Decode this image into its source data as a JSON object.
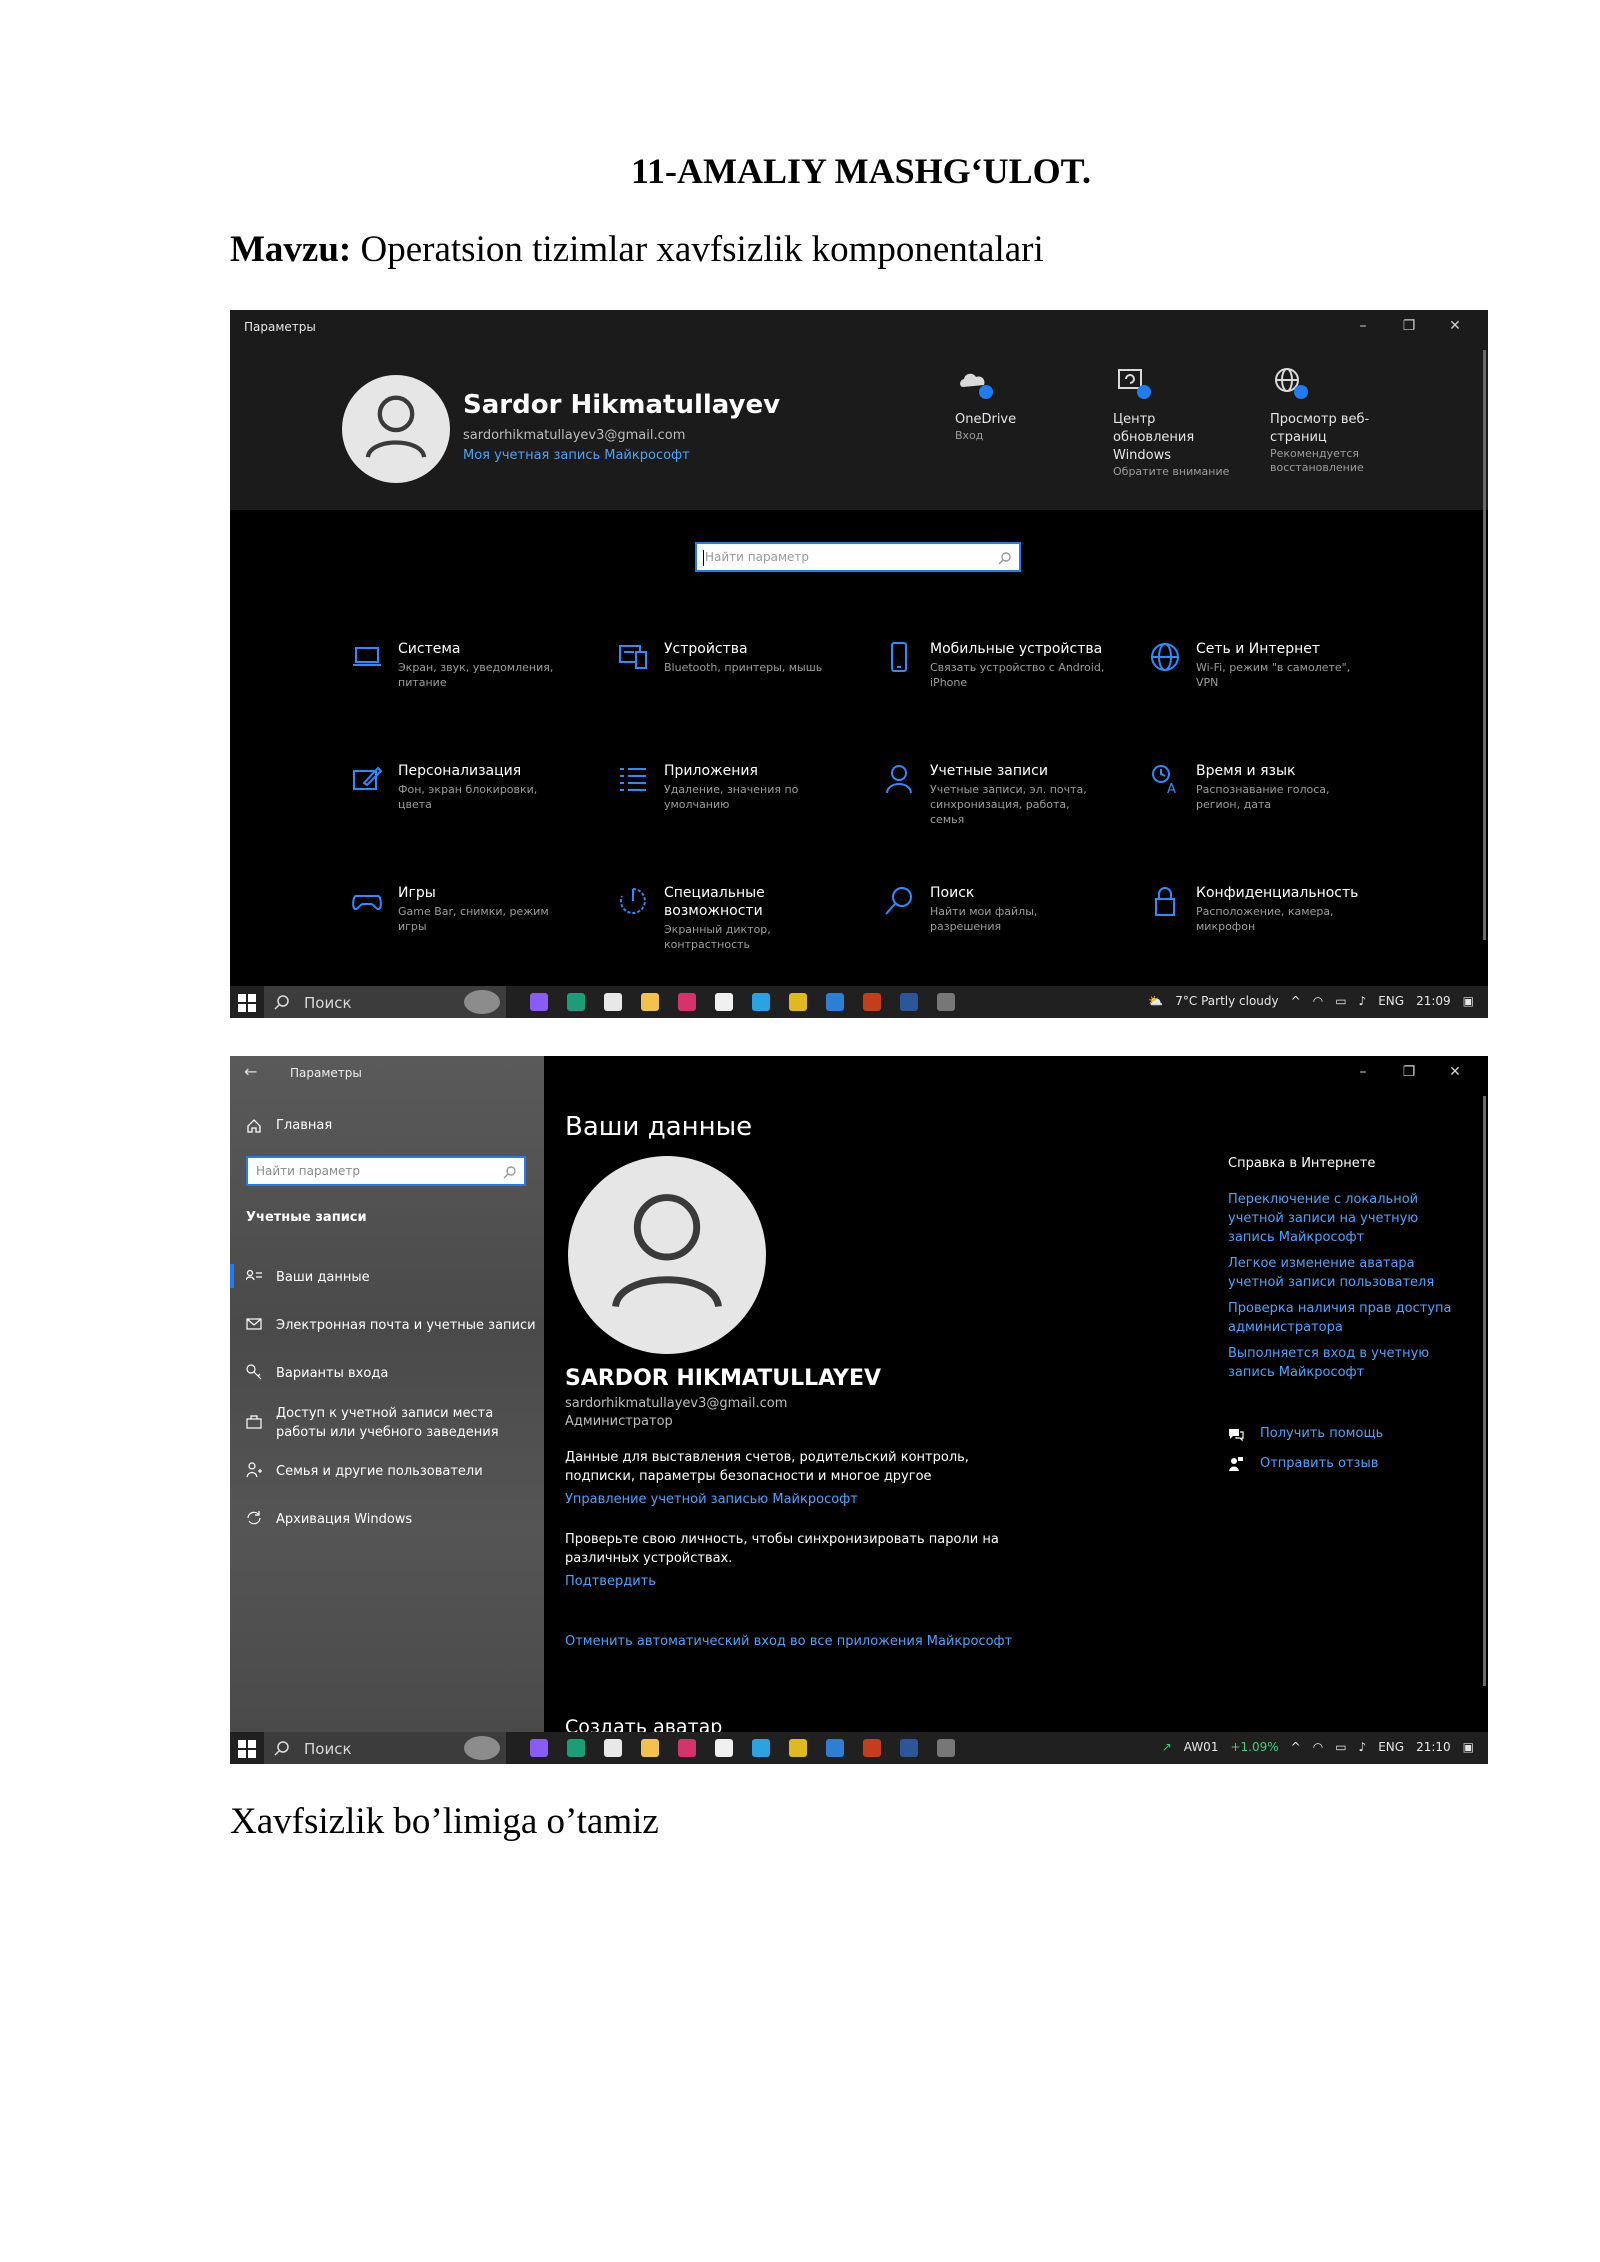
{
  "document": {
    "title": "11-AMALIY MASHG‘ULOT.",
    "topic_label": "Mavzu:",
    "topic_text": " Operatsion tizimlar xavfsizlik komponentalari",
    "caption": "Xavfsizlik bo’limiga o’tamiz"
  },
  "shot1": {
    "window_title": "Параметры",
    "controls": [
      "–",
      "❐",
      "✕"
    ],
    "profile": {
      "name": "Sardor Hikmatullayev",
      "email": "sardorhikmatullayev3@gmail.com",
      "link": "Моя учетная запись Майкрософт"
    },
    "header_tiles": [
      {
        "icon": "onedrive-icon",
        "title": "OneDrive",
        "subtitle": "Вход"
      },
      {
        "icon": "windows-update-icon",
        "title": "Центр обновления Windows",
        "subtitle": "Обратите внимание"
      },
      {
        "icon": "globe-icon",
        "title": "Просмотр веб-страниц",
        "subtitle": "Рекомендуется восстановление"
      }
    ],
    "search_placeholder": "Найти параметр",
    "categories": [
      {
        "icon": "laptop-icon",
        "title": "Система",
        "subtitle": "Экран, звук, уведомления, питание"
      },
      {
        "icon": "devices-icon",
        "title": "Устройства",
        "subtitle": "Bluetooth, принтеры, мышь"
      },
      {
        "icon": "phone-icon",
        "title": "Мобильные устройства",
        "subtitle": "Связать устройство с Android, iPhone"
      },
      {
        "icon": "globe-icon",
        "title": "Сеть и Интернет",
        "subtitle": "Wi-Fi, режим \"в самолете\", VPN"
      },
      {
        "icon": "personalization-icon",
        "title": "Персонализация",
        "subtitle": "Фон, экран блокировки, цвета"
      },
      {
        "icon": "apps-list-icon",
        "title": "Приложения",
        "subtitle": "Удаление, значения по умолчанию"
      },
      {
        "icon": "person-icon",
        "title": "Учетные записи",
        "subtitle": "Учетные записи, эл. почта, синхронизация, работа, семья"
      },
      {
        "icon": "time-language-icon",
        "title": "Время и язык",
        "subtitle": "Распознавание голоса, регион, дата"
      },
      {
        "icon": "gamepad-icon",
        "title": "Игры",
        "subtitle": "Game Bar, снимки, режим игры"
      },
      {
        "icon": "accessibility-icon",
        "title": "Специальные возможности",
        "subtitle": "Экранный диктор, контрастность"
      },
      {
        "icon": "search-icon",
        "title": "Поиск",
        "subtitle": "Найти мои файлы, разрешения"
      },
      {
        "icon": "lock-icon",
        "title": "Конфиденциальность",
        "subtitle": "Расположение, камера, микрофон"
      }
    ],
    "taskbar": {
      "search_label": "Поиск",
      "weather": "7°C  Partly cloudy",
      "lang": "ENG",
      "time": "21:09"
    }
  },
  "shot2": {
    "window_title": "Параметры",
    "back": "←",
    "controls": [
      "–",
      "❐",
      "✕"
    ],
    "sidebar": {
      "home": "Главная",
      "search_placeholder": "Найти параметр",
      "section": "Учетные записи",
      "items": [
        {
          "icon": "user-info-icon",
          "label": "Ваши данные"
        },
        {
          "icon": "mail-icon",
          "label": "Электронная почта и учетные записи"
        },
        {
          "icon": "key-icon",
          "label": "Варианты входа"
        },
        {
          "icon": "briefcase-icon",
          "label": "Доступ к учетной записи места работы или учебного заведения"
        },
        {
          "icon": "family-icon",
          "label": "Семья и другие пользователи"
        },
        {
          "icon": "sync-icon",
          "label": "Архивация Windows"
        }
      ]
    },
    "main": {
      "heading": "Ваши данные",
      "name": "SARDOR HIKMATULLAYEV",
      "email": "sardorhikmatullayev3@gmail.com",
      "role": "Администратор",
      "para1": "Данные для выставления счетов, родительский контроль, подписки, параметры безопасности и многое другое",
      "link1": "Управление учетной записью Майкрософт",
      "para2": "Проверьте свою личность, чтобы синхронизировать пароли на различных устройствах.",
      "link2": "Подтвердить",
      "link3": "Отменить автоматический вход во все приложения Майкрософт",
      "heading2": "Создать аватар"
    },
    "help": {
      "title": "Справка в Интернете",
      "links": [
        "Переключение с локальной учетной записи на учетную запись Майкрософт",
        "Легкое изменение аватара учетной записи пользователя",
        "Проверка наличия прав доступа администратора",
        "Выполняется вход в учетную запись Майкрософт"
      ],
      "get_help": "Получить помощь",
      "feedback": "Отправить отзыв"
    },
    "taskbar": {
      "search_label": "Поиск",
      "ticker": "AW01",
      "change": "+1.09%",
      "lang": "ENG",
      "time": "21:10"
    }
  },
  "colors": {
    "accent": "#1f7cf2",
    "link": "#4aa3ff",
    "window_bg": "#000000",
    "header_bg": "#1b1b1b",
    "taskbar_bg": "#202020",
    "ticker_green": "#3cd070"
  }
}
